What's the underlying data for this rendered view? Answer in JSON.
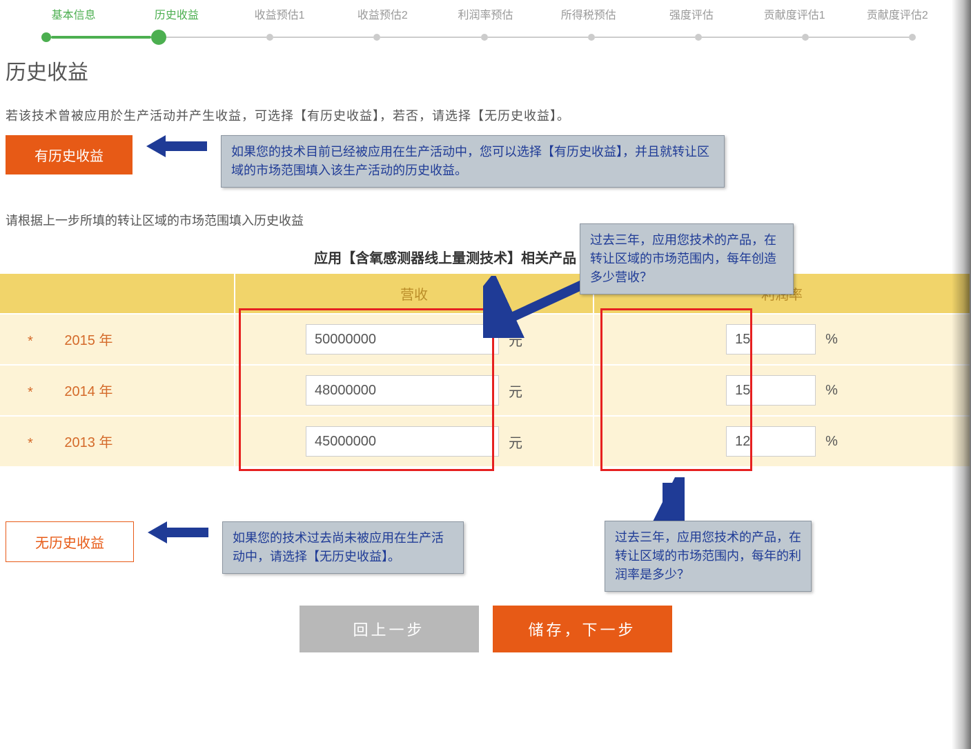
{
  "stepper": {
    "items": [
      {
        "label": "基本信息"
      },
      {
        "label": "历史收益"
      },
      {
        "label": "收益预估1"
      },
      {
        "label": "收益预估2"
      },
      {
        "label": "利润率预估"
      },
      {
        "label": "所得税预估"
      },
      {
        "label": "强度评估"
      },
      {
        "label": "贡献度评估1"
      },
      {
        "label": "贡献度评估2"
      }
    ]
  },
  "page_title": "历史收益",
  "instruction1": "若该技术曾被应用於生产活动并产生收益，可选择【有历史收益】，若否，请选择【无历史收益】。",
  "btn_has_history": "有历史收益",
  "tooltip_has_history": "如果您的技术目前已经被应用在生产活动中，您可以选择【有历史收益】，并且就转让区域的市场范围填入该生产活动的历史收益。",
  "instruction2": "请根据上一步所填的转让区域的市场范围填入历史收益",
  "section_heading": "应用【含氧感测器线上量测技术】相关产品 / 服务产生的",
  "table": {
    "col_revenue": "营收",
    "col_profit": "利润率",
    "unit_currency": "元",
    "unit_percent": "%",
    "required": "*",
    "rows": [
      {
        "year": "2015 年",
        "revenue": "50000000",
        "profit": "15"
      },
      {
        "year": "2014 年",
        "revenue": "48000000",
        "profit": "15"
      },
      {
        "year": "2013 年",
        "revenue": "45000000",
        "profit": "12"
      }
    ]
  },
  "tooltip_revenue": "过去三年，应用您技术的产品，在转让区域的市场范围内，每年创造多少营收？",
  "tooltip_profit": "过去三年，应用您技术的产品，在转让区域的市场范围内，每年的利润率是多少？",
  "btn_no_history": "无历史收益",
  "tooltip_no_history": "如果您的技术过去尚未被应用在生产活动中，请选择【无历史收益】。",
  "btn_prev": "回上一步",
  "btn_next": "储存，下一步"
}
